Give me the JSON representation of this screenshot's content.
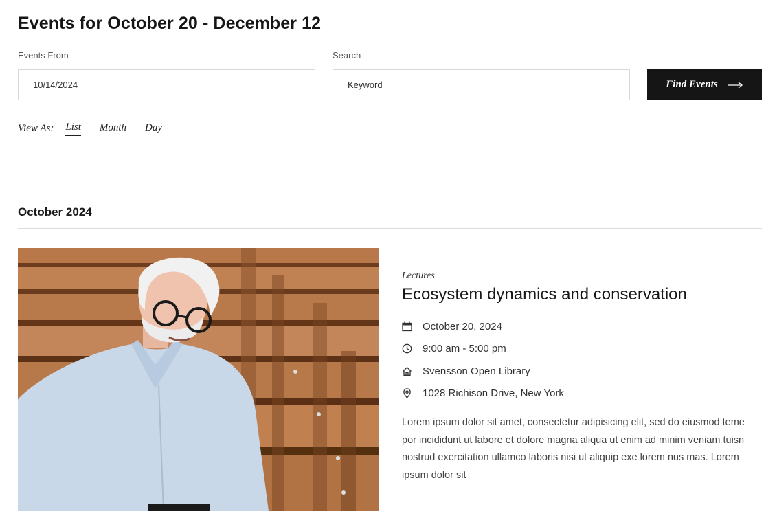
{
  "header": {
    "title": "Events for October 20 - December 12"
  },
  "filters": {
    "from_label": "Events From",
    "from_value": "10/14/2024",
    "search_label": "Search",
    "search_placeholder": "Keyword",
    "find_button": "Find Events"
  },
  "view": {
    "label": "View As:",
    "options": [
      "List",
      "Month",
      "Day"
    ],
    "active": "List"
  },
  "month_heading": "October 2024",
  "event": {
    "category": "Lectures",
    "title": "Ecosystem dynamics and conservation",
    "date": "October 20, 2024",
    "time": "9:00 am - 5:00 pm",
    "venue": "Svensson Open Library",
    "address": "1028 Richison Drive, New York",
    "description": "Lorem ipsum dolor sit amet, consectetur adipisicing elit, sed do eiusmod teme por incididunt ut labore et dolore magna aliqua ut enim ad minim veniam tuisn nostrud exercitation ullamco laboris nisi ut aliquip exe lorem nus mas. Lorem ipsum dolor sit",
    "icons": {
      "date": "calendar-icon",
      "time": "clock-icon",
      "venue": "home-icon",
      "address": "map-pin-icon"
    }
  }
}
